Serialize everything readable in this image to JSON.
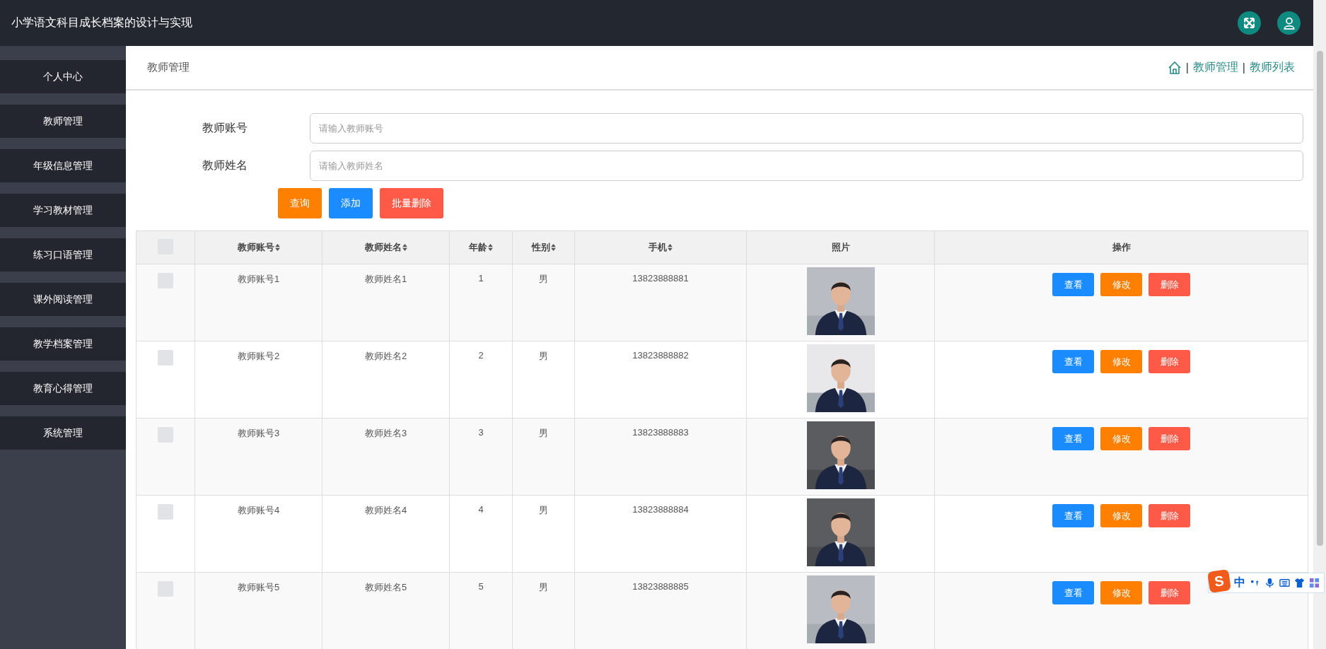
{
  "header": {
    "title": "小学语文科目成长档案的设计与实现"
  },
  "sidebar": {
    "items": [
      {
        "label": "个人中心"
      },
      {
        "label": "教师管理"
      },
      {
        "label": "年级信息管理"
      },
      {
        "label": "学习教材管理"
      },
      {
        "label": "练习口语管理"
      },
      {
        "label": "课外阅读管理"
      },
      {
        "label": "教学档案管理"
      },
      {
        "label": "教育心得管理"
      },
      {
        "label": "系统管理"
      }
    ]
  },
  "breadcrumb": {
    "page_title": "教师管理",
    "separator": "|",
    "crumbs": [
      "教师管理",
      "教师列表"
    ]
  },
  "search": {
    "fields": [
      {
        "label": "教师账号",
        "placeholder": "请输入教师账号"
      },
      {
        "label": "教师姓名",
        "placeholder": "请输入教师姓名"
      }
    ],
    "buttons": [
      {
        "label": "查询",
        "kind": "search"
      },
      {
        "label": "添加",
        "kind": "add"
      },
      {
        "label": "批量删除",
        "kind": "batch_delete"
      }
    ]
  },
  "table": {
    "columns": [
      {
        "kind": "checkbox",
        "checked": false
      },
      {
        "label": "教师账号",
        "sortable": true
      },
      {
        "label": "教师姓名",
        "sortable": true
      },
      {
        "label": "年龄",
        "sortable": true
      },
      {
        "label": "性别",
        "sortable": true
      },
      {
        "label": "手机",
        "sortable": true
      },
      {
        "label": "照片",
        "sortable": false
      },
      {
        "label": "操作",
        "sortable": false
      }
    ],
    "rows": [
      {
        "checked": false,
        "account": "教师账号1",
        "name": "教师姓名1",
        "age": "1",
        "gender": "男",
        "phone": "13823888881",
        "actions": [
          {
            "label": "查看",
            "kind": "view"
          },
          {
            "label": "修改",
            "kind": "edit"
          },
          {
            "label": "删除",
            "kind": "delete"
          }
        ]
      },
      {
        "checked": false,
        "account": "教师账号2",
        "name": "教师姓名2",
        "age": "2",
        "gender": "男",
        "phone": "13823888882",
        "actions": [
          {
            "label": "查看",
            "kind": "view"
          },
          {
            "label": "修改",
            "kind": "edit"
          },
          {
            "label": "删除",
            "kind": "delete"
          }
        ]
      },
      {
        "checked": false,
        "account": "教师账号3",
        "name": "教师姓名3",
        "age": "3",
        "gender": "男",
        "phone": "13823888883",
        "actions": [
          {
            "label": "查看",
            "kind": "view"
          },
          {
            "label": "修改",
            "kind": "edit"
          },
          {
            "label": "删除",
            "kind": "delete"
          }
        ]
      },
      {
        "checked": false,
        "account": "教师账号4",
        "name": "教师姓名4",
        "age": "4",
        "gender": "男",
        "phone": "13823888884",
        "actions": [
          {
            "label": "查看",
            "kind": "view"
          },
          {
            "label": "修改",
            "kind": "edit"
          },
          {
            "label": "删除",
            "kind": "delete"
          }
        ]
      },
      {
        "checked": false,
        "account": "教师账号5",
        "name": "教师姓名5",
        "age": "5",
        "gender": "男",
        "phone": "13823888885",
        "actions": [
          {
            "label": "查看",
            "kind": "view"
          },
          {
            "label": "修改",
            "kind": "edit"
          },
          {
            "label": "删除",
            "kind": "delete"
          }
        ]
      }
    ]
  },
  "ime_toolbar": {
    "logo": "S",
    "mode": "中"
  }
}
